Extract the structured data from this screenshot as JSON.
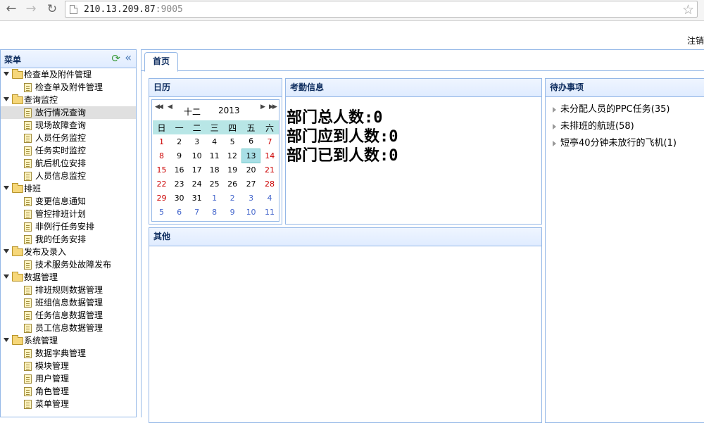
{
  "browser": {
    "url_host": "210.13.209.87",
    "url_port": ":9005"
  },
  "header": {
    "logout_label": "注销"
  },
  "menu": {
    "title": "菜单",
    "groups": [
      {
        "label": "检查单及附件管理",
        "items": [
          "检查单及附件管理"
        ]
      },
      {
        "label": "查询监控",
        "items": [
          "放行情况查询",
          "现场故障查询",
          "人员任务监控",
          "任务实时监控",
          "航后机位安排",
          "人员信息监控"
        ]
      },
      {
        "label": "排班",
        "items": [
          "变更信息通知",
          "管控排班计划",
          "非例行任务安排",
          "我的任务安排"
        ]
      },
      {
        "label": "发布及录入",
        "items": [
          "技术服务处故障发布"
        ]
      },
      {
        "label": "数据管理",
        "items": [
          "排班规则数据管理",
          "班组信息数据管理",
          "任务信息数据管理",
          "员工信息数据管理"
        ]
      },
      {
        "label": "系统管理",
        "items": [
          "数据字典管理",
          "模块管理",
          "用户管理",
          "角色管理",
          "菜单管理"
        ]
      }
    ]
  },
  "tabs": {
    "home_label": "首页"
  },
  "calendar": {
    "title": "日历",
    "month": "十二",
    "year": "2013",
    "weekdays": [
      "日",
      "一",
      "二",
      "三",
      "四",
      "五",
      "六"
    ],
    "weeks": [
      [
        "1",
        "2",
        "3",
        "4",
        "5",
        "6",
        "7"
      ],
      [
        "8",
        "9",
        "10",
        "11",
        "12",
        "13",
        "14"
      ],
      [
        "15",
        "16",
        "17",
        "18",
        "19",
        "20",
        "21"
      ],
      [
        "22",
        "23",
        "24",
        "25",
        "26",
        "27",
        "28"
      ],
      [
        "29",
        "30",
        "31",
        "1",
        "2",
        "3",
        "4"
      ],
      [
        "5",
        "6",
        "7",
        "8",
        "9",
        "10",
        "11"
      ]
    ],
    "today": "13"
  },
  "attendance": {
    "title": "考勤信息",
    "total": "部门总人数:0",
    "expected": "部门应到人数:0",
    "arrived": "部门已到人数:0"
  },
  "todo": {
    "title": "待办事项",
    "items": [
      "未分配人员的PPC任务(35)",
      "未排班的航班(58)",
      "短亭40分钟未放行的飞机(1)"
    ]
  },
  "other": {
    "title": "其他"
  }
}
